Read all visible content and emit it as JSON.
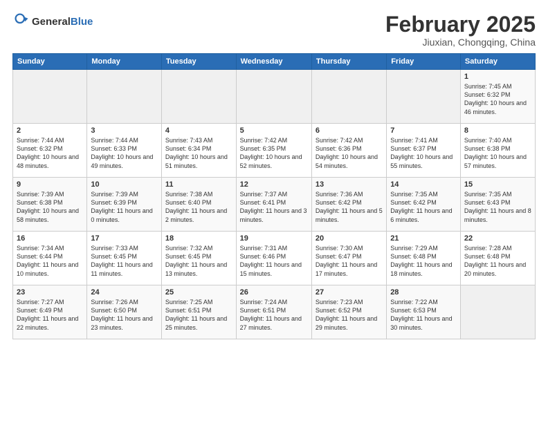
{
  "header": {
    "logo_general": "General",
    "logo_blue": "Blue",
    "month_title": "February 2025",
    "location": "Jiuxian, Chongqing, China"
  },
  "days_of_week": [
    "Sunday",
    "Monday",
    "Tuesday",
    "Wednesday",
    "Thursday",
    "Friday",
    "Saturday"
  ],
  "weeks": [
    [
      {
        "day": "",
        "info": ""
      },
      {
        "day": "",
        "info": ""
      },
      {
        "day": "",
        "info": ""
      },
      {
        "day": "",
        "info": ""
      },
      {
        "day": "",
        "info": ""
      },
      {
        "day": "",
        "info": ""
      },
      {
        "day": "1",
        "info": "Sunrise: 7:45 AM\nSunset: 6:32 PM\nDaylight: 10 hours and 46 minutes."
      }
    ],
    [
      {
        "day": "2",
        "info": "Sunrise: 7:44 AM\nSunset: 6:32 PM\nDaylight: 10 hours and 48 minutes."
      },
      {
        "day": "3",
        "info": "Sunrise: 7:44 AM\nSunset: 6:33 PM\nDaylight: 10 hours and 49 minutes."
      },
      {
        "day": "4",
        "info": "Sunrise: 7:43 AM\nSunset: 6:34 PM\nDaylight: 10 hours and 51 minutes."
      },
      {
        "day": "5",
        "info": "Sunrise: 7:42 AM\nSunset: 6:35 PM\nDaylight: 10 hours and 52 minutes."
      },
      {
        "day": "6",
        "info": "Sunrise: 7:42 AM\nSunset: 6:36 PM\nDaylight: 10 hours and 54 minutes."
      },
      {
        "day": "7",
        "info": "Sunrise: 7:41 AM\nSunset: 6:37 PM\nDaylight: 10 hours and 55 minutes."
      },
      {
        "day": "8",
        "info": "Sunrise: 7:40 AM\nSunset: 6:38 PM\nDaylight: 10 hours and 57 minutes."
      }
    ],
    [
      {
        "day": "9",
        "info": "Sunrise: 7:39 AM\nSunset: 6:38 PM\nDaylight: 10 hours and 58 minutes."
      },
      {
        "day": "10",
        "info": "Sunrise: 7:39 AM\nSunset: 6:39 PM\nDaylight: 11 hours and 0 minutes."
      },
      {
        "day": "11",
        "info": "Sunrise: 7:38 AM\nSunset: 6:40 PM\nDaylight: 11 hours and 2 minutes."
      },
      {
        "day": "12",
        "info": "Sunrise: 7:37 AM\nSunset: 6:41 PM\nDaylight: 11 hours and 3 minutes."
      },
      {
        "day": "13",
        "info": "Sunrise: 7:36 AM\nSunset: 6:42 PM\nDaylight: 11 hours and 5 minutes."
      },
      {
        "day": "14",
        "info": "Sunrise: 7:35 AM\nSunset: 6:42 PM\nDaylight: 11 hours and 6 minutes."
      },
      {
        "day": "15",
        "info": "Sunrise: 7:35 AM\nSunset: 6:43 PM\nDaylight: 11 hours and 8 minutes."
      }
    ],
    [
      {
        "day": "16",
        "info": "Sunrise: 7:34 AM\nSunset: 6:44 PM\nDaylight: 11 hours and 10 minutes."
      },
      {
        "day": "17",
        "info": "Sunrise: 7:33 AM\nSunset: 6:45 PM\nDaylight: 11 hours and 11 minutes."
      },
      {
        "day": "18",
        "info": "Sunrise: 7:32 AM\nSunset: 6:45 PM\nDaylight: 11 hours and 13 minutes."
      },
      {
        "day": "19",
        "info": "Sunrise: 7:31 AM\nSunset: 6:46 PM\nDaylight: 11 hours and 15 minutes."
      },
      {
        "day": "20",
        "info": "Sunrise: 7:30 AM\nSunset: 6:47 PM\nDaylight: 11 hours and 17 minutes."
      },
      {
        "day": "21",
        "info": "Sunrise: 7:29 AM\nSunset: 6:48 PM\nDaylight: 11 hours and 18 minutes."
      },
      {
        "day": "22",
        "info": "Sunrise: 7:28 AM\nSunset: 6:48 PM\nDaylight: 11 hours and 20 minutes."
      }
    ],
    [
      {
        "day": "23",
        "info": "Sunrise: 7:27 AM\nSunset: 6:49 PM\nDaylight: 11 hours and 22 minutes."
      },
      {
        "day": "24",
        "info": "Sunrise: 7:26 AM\nSunset: 6:50 PM\nDaylight: 11 hours and 23 minutes."
      },
      {
        "day": "25",
        "info": "Sunrise: 7:25 AM\nSunset: 6:51 PM\nDaylight: 11 hours and 25 minutes."
      },
      {
        "day": "26",
        "info": "Sunrise: 7:24 AM\nSunset: 6:51 PM\nDaylight: 11 hours and 27 minutes."
      },
      {
        "day": "27",
        "info": "Sunrise: 7:23 AM\nSunset: 6:52 PM\nDaylight: 11 hours and 29 minutes."
      },
      {
        "day": "28",
        "info": "Sunrise: 7:22 AM\nSunset: 6:53 PM\nDaylight: 11 hours and 30 minutes."
      },
      {
        "day": "",
        "info": ""
      }
    ]
  ]
}
